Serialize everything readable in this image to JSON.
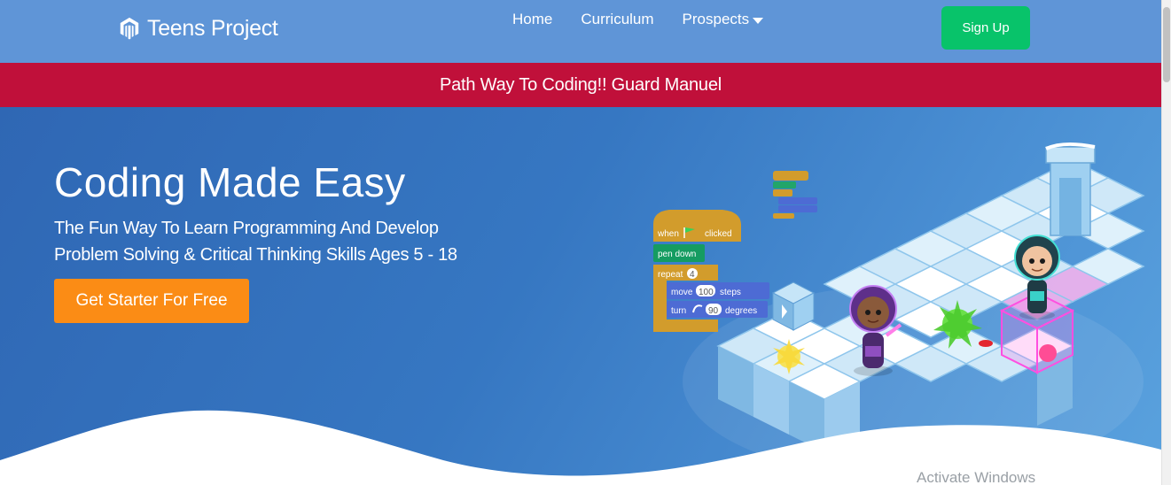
{
  "navbar": {
    "brand_name": "Teens Project",
    "brand_icon": "magento-logo-icon",
    "links": [
      {
        "label": "Home"
      },
      {
        "label": "Curriculum"
      },
      {
        "label": "Prospects",
        "has_dropdown": true
      }
    ],
    "signup_label": "Sign Up"
  },
  "banner": {
    "text": "Path Way To Coding!! Guard Manuel"
  },
  "hero": {
    "title": "Coding Made Easy",
    "subtitle_line1": "The Fun Way To Learn Programming And Develop",
    "subtitle_line2": "Problem Solving & Critical Thinking Skills Ages 5 - 18",
    "cta_label": "Get Starter For Free",
    "blocks": {
      "when": "when",
      "clicked": "clicked",
      "pen_down": "pen down",
      "repeat": "repeat",
      "repeat_count": "4",
      "move": "move",
      "move_steps": "100",
      "steps": "steps",
      "turn": "turn",
      "turn_degrees": "90",
      "degrees": "degrees"
    }
  },
  "watermark": "Activate Windows",
  "colors": {
    "navbar": "#5f95d7",
    "banner": "#c0103a",
    "signup": "#08c36a",
    "cta": "#fb8c15",
    "hero": "#3677c2"
  }
}
